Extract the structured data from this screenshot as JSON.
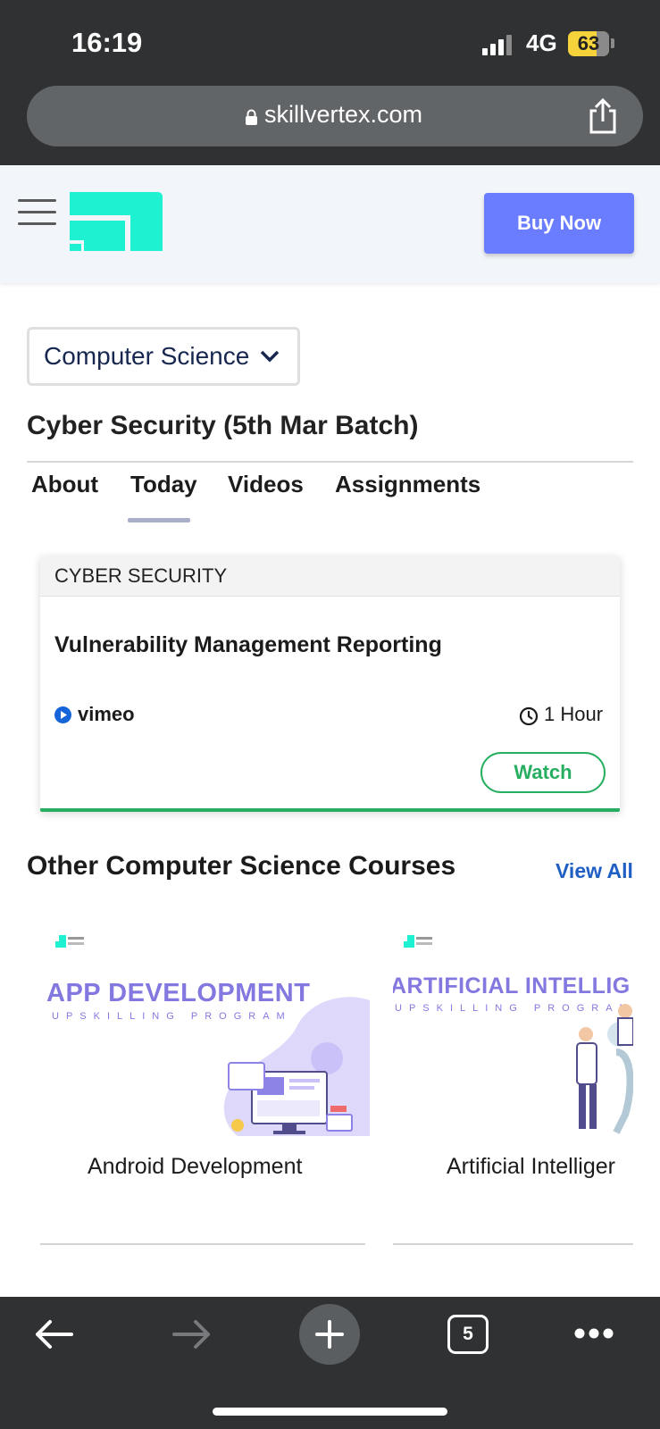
{
  "status_bar": {
    "time": "16:19",
    "network": "4G",
    "battery": "63"
  },
  "browser": {
    "url": "skillvertex.com",
    "tab_count": "5"
  },
  "header": {
    "buy_button": "Buy Now"
  },
  "category_select": {
    "value": "Computer Science"
  },
  "course": {
    "title": "Cyber Security (5th Mar Batch)"
  },
  "tabs": [
    {
      "label": "About"
    },
    {
      "label": "Today"
    },
    {
      "label": "Videos"
    },
    {
      "label": "Assignments"
    }
  ],
  "active_tab": "Today",
  "session_card": {
    "category": "CYBER SECURITY",
    "title": "Vulnerability Management Reporting",
    "platform": "vimeo",
    "duration": "1 Hour",
    "action": "Watch"
  },
  "other_courses": {
    "title": "Other Computer Science Courses",
    "view_all": "View All",
    "items": [
      {
        "banner_heading": "APP DEVELOPMENT",
        "banner_sub": "UPSKILLING PROGRAM",
        "name": "Android Development"
      },
      {
        "banner_heading": "ARTIFICIAL INTELLIG",
        "banner_sub": "UPSKILLING PROGRAM",
        "name": "Artificial Intelliger"
      }
    ]
  },
  "colors": {
    "accent": "#6a7cff",
    "logo": "#1ef0d2",
    "success": "#27ae60",
    "link": "#1f5fc4",
    "banner_text": "#8378e0"
  }
}
